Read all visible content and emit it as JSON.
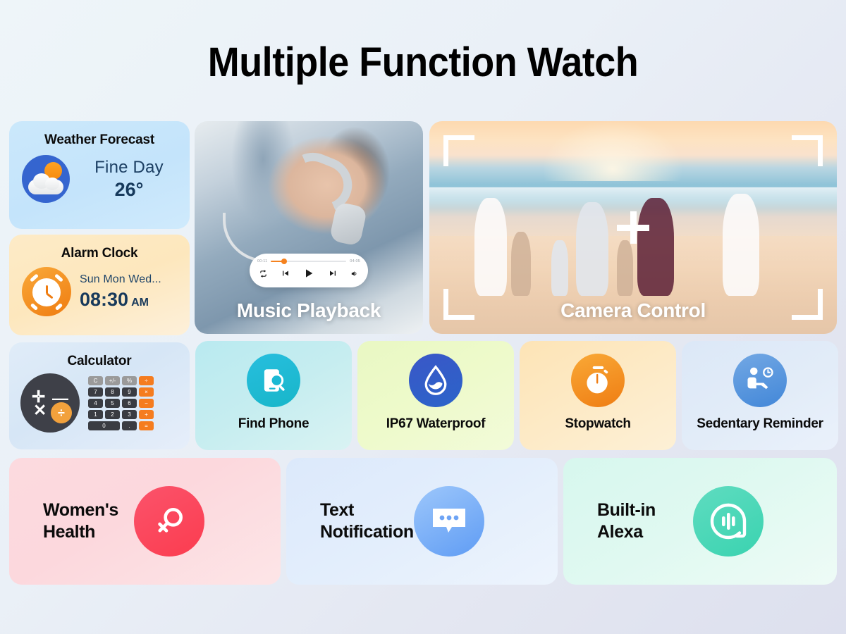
{
  "header": {
    "title": "Multiple Function Watch"
  },
  "weather": {
    "title": "Weather Forecast",
    "condition": "Fine Day",
    "temperature": "26°",
    "icon": "sun-behind-cloud-icon",
    "card_color": "#c9e6fb",
    "icon_circle_color": "#3565cf"
  },
  "alarm": {
    "title": "Alarm Clock",
    "days": "Sun Mon Wed...",
    "time": "08:30",
    "meridiem": "AM",
    "icon": "alarm-clock-icon",
    "card_color": "#fde7bd",
    "icon_circle_color": "#ef7c10"
  },
  "calculator": {
    "title": "Calculator",
    "icon": "calculator-operators-icon",
    "operators": [
      "+",
      "−",
      "×",
      "÷"
    ],
    "keypad": [
      {
        "label": "C",
        "style": "gray"
      },
      {
        "label": "+/-",
        "style": "gray"
      },
      {
        "label": "%",
        "style": "gray"
      },
      {
        "label": "÷",
        "style": "orange"
      },
      {
        "label": "7",
        "style": "dark"
      },
      {
        "label": "8",
        "style": "dark"
      },
      {
        "label": "9",
        "style": "dark"
      },
      {
        "label": "×",
        "style": "orange"
      },
      {
        "label": "4",
        "style": "dark"
      },
      {
        "label": "5",
        "style": "dark"
      },
      {
        "label": "6",
        "style": "dark"
      },
      {
        "label": "−",
        "style": "orange"
      },
      {
        "label": "1",
        "style": "dark"
      },
      {
        "label": "2",
        "style": "dark"
      },
      {
        "label": "3",
        "style": "dark"
      },
      {
        "label": "+",
        "style": "orange"
      },
      {
        "label": "0",
        "style": "dark wide"
      },
      {
        "label": ".",
        "style": "dark"
      },
      {
        "label": "=",
        "style": "orange"
      }
    ],
    "card_color": "#dbe8f7"
  },
  "music": {
    "label": "Music Playback",
    "elapsed": "00:11",
    "duration": "04:05",
    "progress_percent": 17,
    "controls": [
      "repeat-icon",
      "previous-track-icon",
      "play-icon",
      "next-track-icon",
      "volume-icon"
    ],
    "accent_color": "#f5821f"
  },
  "camera": {
    "label": "Camera Control",
    "overlay": "viewfinder-brackets-and-crosshair"
  },
  "features": [
    {
      "label": "Find Phone",
      "icon": "phone-search-icon",
      "card_color": "#c6edf0",
      "circle_color": "#1ab9d4"
    },
    {
      "label": "IP67 Waterproof",
      "icon": "water-drop-icon",
      "card_color": "#eefacb",
      "circle_color": "#2f5dc8"
    },
    {
      "label": "Stopwatch",
      "icon": "stopwatch-icon",
      "card_color": "#fdeac6",
      "circle_color": "#f18c1d"
    },
    {
      "label": "Sedentary Reminder",
      "icon": "seated-person-clock-icon",
      "card_color": "#e2ecf8",
      "circle_color": "#4f8eda"
    }
  ],
  "bottom": [
    {
      "label": "Women's Health",
      "line1": "Women's",
      "line2": "Health",
      "icon": "venus-symbol-icon",
      "card_color": "#fcd8dd",
      "circle_color": "#fb4459"
    },
    {
      "label": "Text Notification",
      "line1": "Text",
      "line2": "Notification",
      "icon": "speech-bubble-dots-icon",
      "card_color": "#e3eefc",
      "circle_color": "#6ea4f5"
    },
    {
      "label": "Built-in Alexa",
      "line1": "Built-in",
      "line2": "Alexa",
      "icon": "voice-assistant-icon",
      "card_color": "#e0f9f1",
      "circle_color": "#3fd4b2"
    }
  ]
}
